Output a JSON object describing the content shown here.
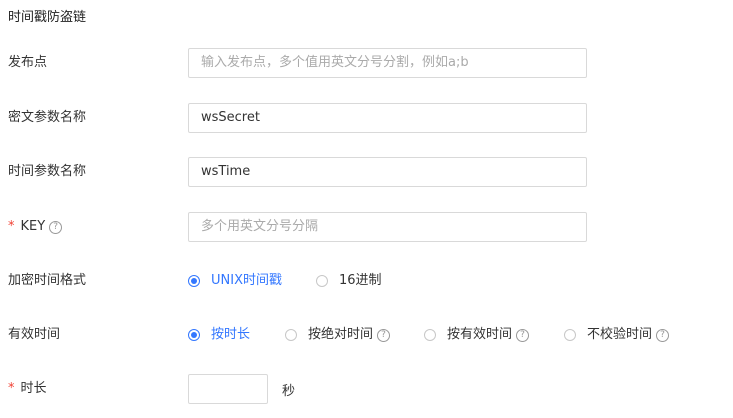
{
  "section_title": "时间戳防盗链",
  "fields": {
    "origin": {
      "label": "发布点",
      "placeholder": "输入发布点，多个值用英文分号分割，例如a;b"
    },
    "secret_param": {
      "label": "密文参数名称",
      "value": "wsSecret"
    },
    "time_param": {
      "label": "时间参数名称",
      "value": "wsTime"
    },
    "key": {
      "required_mark": "*",
      "label": "KEY",
      "help_icon": "question-circle-icon",
      "placeholder": "多个用英文分号分隔"
    }
  },
  "encrypt_time_format": {
    "label": "加密时间格式",
    "options": [
      {
        "label": "UNIX时间戳",
        "selected": true
      },
      {
        "label": "16进制",
        "selected": false
      }
    ]
  },
  "valid_time": {
    "label": "有效时间",
    "options": [
      {
        "label": "按时长",
        "selected": true,
        "help": false
      },
      {
        "label": "按绝对时间",
        "selected": false,
        "help": true
      },
      {
        "label": "按有效时间",
        "selected": false,
        "help": true
      },
      {
        "label": "不校验时间",
        "selected": false,
        "help": true
      }
    ]
  },
  "duration": {
    "required_mark": "*",
    "label": "时长",
    "value": "",
    "unit": "秒"
  },
  "colors": {
    "accent": "#3377ff",
    "required": "#f04134",
    "border": "#d9d9d9",
    "placeholder": "#aaaaaa"
  }
}
